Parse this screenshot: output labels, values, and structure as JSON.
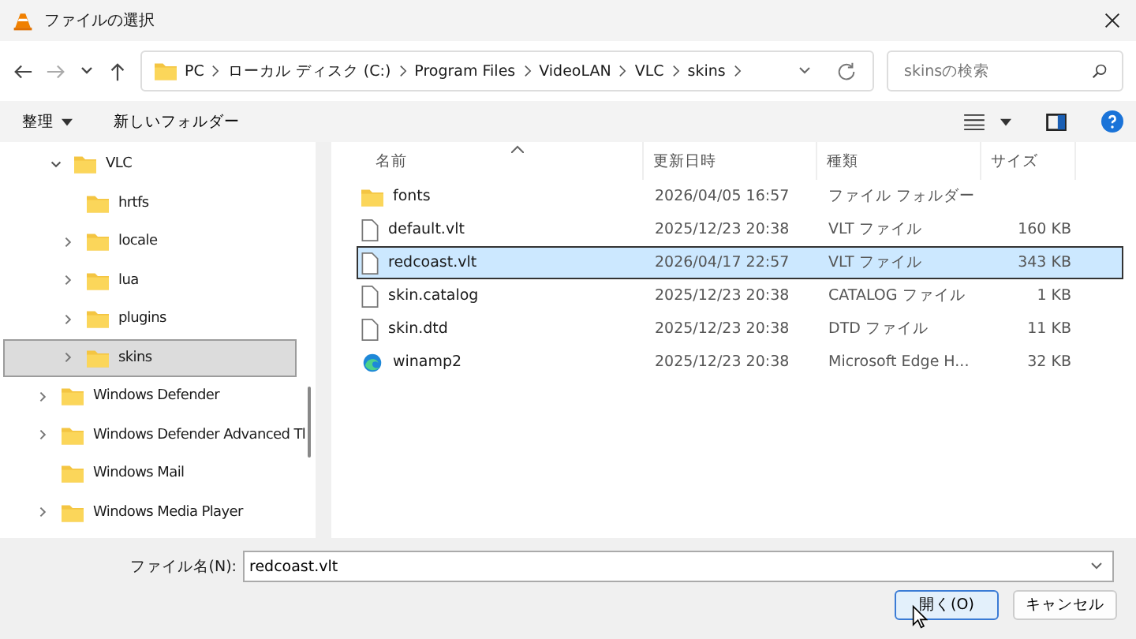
{
  "window": {
    "title": "ファイルの選択"
  },
  "breadcrumb": [
    "PC",
    "ローカル ディスク (C:)",
    "Program Files",
    "VideoLAN",
    "VLC",
    "skins"
  ],
  "search": {
    "placeholder": "skinsの検索"
  },
  "toolbar": {
    "organize": "整理",
    "new_folder": "新しいフォルダー"
  },
  "tree": [
    {
      "label": "VLC",
      "expanded": true,
      "selected": false,
      "children": [
        {
          "label": "hrtfs",
          "expandable": false,
          "selected": false
        },
        {
          "label": "locale",
          "expandable": true,
          "selected": false
        },
        {
          "label": "lua",
          "expandable": true,
          "selected": false
        },
        {
          "label": "plugins",
          "expandable": true,
          "selected": false
        },
        {
          "label": "skins",
          "expandable": true,
          "selected": true
        }
      ]
    },
    {
      "label": "Windows Defender",
      "expandable": true,
      "selected": false
    },
    {
      "label": "Windows Defender Advanced Tl",
      "expandable": true,
      "selected": false
    },
    {
      "label": "Windows Mail",
      "expandable": false,
      "selected": false
    },
    {
      "label": "Windows Media Player",
      "expandable": true,
      "selected": false
    }
  ],
  "table": {
    "columns": [
      "名前",
      "更新日時",
      "種類",
      "サイズ"
    ],
    "rows": [
      {
        "kind": "folder",
        "name": "fonts",
        "date": "2026/04/05 16:57",
        "type": "ファイル フォルダー",
        "size": "",
        "selected": false
      },
      {
        "kind": "file",
        "name": "default.vlt",
        "date": "2025/12/23 20:38",
        "type": "VLT ファイル",
        "size": "160 KB",
        "selected": false
      },
      {
        "kind": "file",
        "name": "redcoast.vlt",
        "date": "2026/04/17 22:57",
        "type": "VLT ファイル",
        "size": "343 KB",
        "selected": true
      },
      {
        "kind": "file",
        "name": "skin.catalog",
        "date": "2025/12/23 20:38",
        "type": "CATALOG ファイル",
        "size": "1 KB",
        "selected": false
      },
      {
        "kind": "file",
        "name": "skin.dtd",
        "date": "2025/12/23 20:38",
        "type": "DTD ファイル",
        "size": "11 KB",
        "selected": false
      },
      {
        "kind": "edge",
        "name": "winamp2",
        "date": "2025/12/23 20:38",
        "type": "Microsoft Edge H...",
        "size": "32 KB",
        "selected": false
      }
    ]
  },
  "filename": {
    "label": "ファイル名(N):",
    "value": "redcoast.vlt"
  },
  "buttons": [
    {
      "label": "開く(O)",
      "default": true
    },
    {
      "label": "キャンセル",
      "default": false
    }
  ]
}
